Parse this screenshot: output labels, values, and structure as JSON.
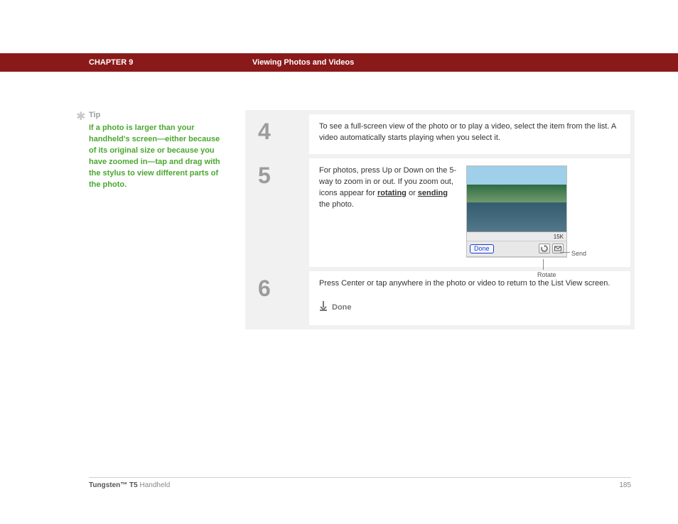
{
  "header": {
    "chapter": "CHAPTER 9",
    "title": "Viewing Photos and Videos"
  },
  "tip": {
    "heading": "Tip",
    "body": "If a photo is larger than your handheld's screen—either because of its original size or because you have zoomed in—tap and drag with the stylus to view different parts of the photo."
  },
  "steps": {
    "s4": {
      "num": "4",
      "text": "To see a full-screen view of the photo or to play a video, select the item from the list. A video automatically starts playing when you select it."
    },
    "s5": {
      "num": "5",
      "text_before": "For photos, press Up or Down on the 5-way to zoom in or out. If you zoom out, icons appear for ",
      "link_rotating": "rotating",
      "text_or": " or ",
      "link_sending": "sending",
      "text_after": " the photo.",
      "device": {
        "filesize": "15K",
        "done_label": "Done",
        "callout_send": "Send",
        "callout_rotate": "Rotate"
      }
    },
    "s6": {
      "num": "6",
      "text": "Press Center or tap anywhere in the photo or video to return to the List View screen.",
      "done_label": "Done"
    }
  },
  "footer": {
    "product_bold": "Tungsten™ T5",
    "product_rest": " Handheld",
    "page_number": "185"
  }
}
